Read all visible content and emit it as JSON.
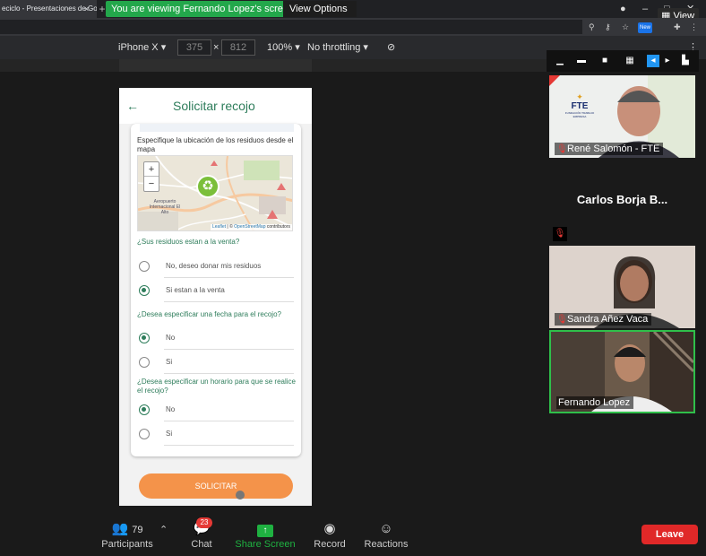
{
  "browser": {
    "tab_title": "eciclo - Presentaciones de Go",
    "tab_close": "×",
    "tab_add": "+",
    "banner": "You are viewing Fernando Lopez's screen",
    "view_options": "View Options",
    "view_button": "View",
    "new_badge": "New"
  },
  "devtools": {
    "device": "iPhone X",
    "width": "375",
    "times": "×",
    "height": "812",
    "zoom": "100%",
    "throttling": "No throttling"
  },
  "app": {
    "title": "Solicitar recojo",
    "location_label": "Especifique la ubicación de los residuos desde el mapa",
    "map": {
      "zoom_in": "+",
      "zoom_out": "−",
      "attribution_leaflet": "Leaflet",
      "attribution_sep": " | © ",
      "attribution_osm": "OpenStreetMap",
      "attribution_contrib": " contributors",
      "place_label": "Aeropuerto Internacional El Alto"
    },
    "questions": [
      {
        "label": "¿Sus residuos estan a la venta?",
        "options": [
          {
            "label": "No, deseo donar mis residuos",
            "selected": false
          },
          {
            "label": "Si estan a la venta",
            "selected": true
          }
        ]
      },
      {
        "label": "¿Desea especificar una fecha para el recojo?",
        "options": [
          {
            "label": "No",
            "selected": true
          },
          {
            "label": "Si",
            "selected": false
          }
        ]
      },
      {
        "label": "¿Desea especificar un horario para que se realice el recojo?",
        "options": [
          {
            "label": "No",
            "selected": true
          },
          {
            "label": "Si",
            "selected": false
          }
        ]
      }
    ],
    "submit": "SOLICITAR"
  },
  "participants_gallery": [
    {
      "name": "René Salomón - FTE",
      "muted": true,
      "video": true
    },
    {
      "name": "Carlos Borja B...",
      "muted": true,
      "video": false
    },
    {
      "name": "Sandra Añez Vaca",
      "muted": true,
      "video": true
    },
    {
      "name": "Fernando Lopez",
      "muted": false,
      "video": true,
      "active_speaker": true
    }
  ],
  "tile_logo": {
    "name": "FTE",
    "sub": "FUNDACIÓN TRABAJO EMPRESA"
  },
  "toolbar": {
    "participants_label": "Participants",
    "participants_count": "79",
    "chat_label": "Chat",
    "chat_badge": "23",
    "share_label": "Share Screen",
    "record_label": "Record",
    "reactions_label": "Reactions",
    "leave_label": "Leave"
  },
  "colors": {
    "app_green": "#2e7d5b",
    "submit_orange": "#f4934a",
    "banner_green": "#23a74b",
    "leave_red": "#e02828"
  }
}
